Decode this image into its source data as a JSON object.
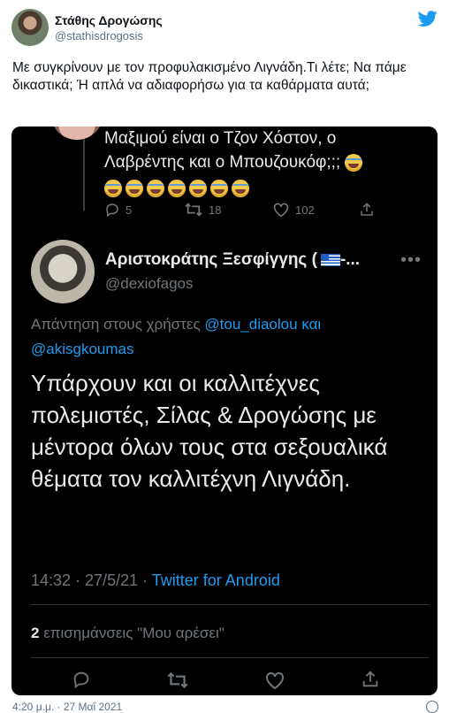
{
  "author": {
    "name": "Στάθης Δρογώσης",
    "handle": "@stathisdrogosis"
  },
  "tweet_text": "Με συγκρίνουν με τον προφυλακισμένο Λιγνάδη.Τι λέτε; Να πάμε δικαστικά; Ή απλά να αδιαφορήσω για τα καθάρματα αυτά;",
  "embed": {
    "prev_tweet": {
      "line1": "Μαξιμού είναι ο Τζον Χόστον, ο",
      "line2": "Λαβρέντης και ο Μπουζουκόφ;;;",
      "replies": "5",
      "retweets": "18",
      "likes": "102"
    },
    "main": {
      "name": "Αριστοκράτης Ξεσφίγγης (",
      "name_suffix": "-...",
      "handle": "@dexiofagos",
      "reply_prefix": "Απάντηση στους χρήστες",
      "mention1": "@tou_diaolou και",
      "mention2": "@akisgkoumas",
      "text": "Υπάρχουν και οι καλλιτέχνες πολεμιστές, Σίλας & Δρογώσης με μέντορα όλων τους στα σεξουαλικά θέματα τον καλλιτέχνη Λιγνάδη.",
      "timestamp": "14:32 · 27/5/21 · ",
      "source": "Twitter for Android",
      "likes_count": "2",
      "likes_label": "επισημάνσεις \"Μου αρέσει\""
    }
  },
  "footer": {
    "timestamp": "4:20 μ.μ. · 27 Μαΐ 2021"
  },
  "colors": {
    "accent": "#1d9bf0",
    "embed_bg": "#000000",
    "secondary": "#71767b"
  }
}
